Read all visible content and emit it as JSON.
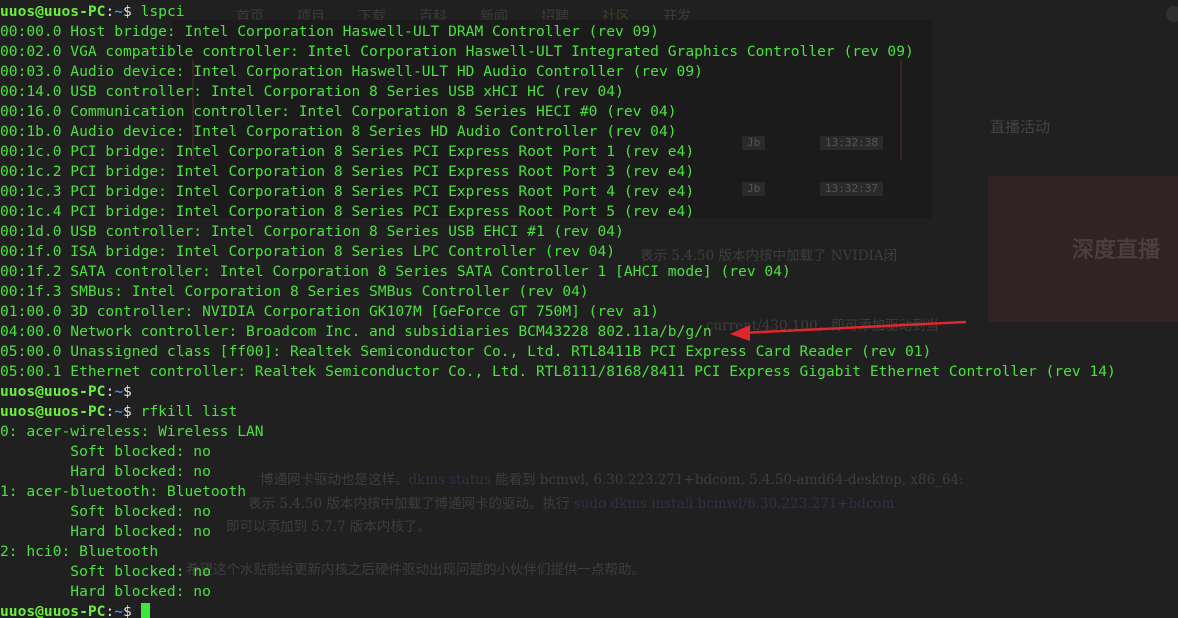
{
  "background_page": {
    "nav": [
      "首页",
      "项目",
      "下载",
      "百科",
      "新闻",
      "招聘",
      "社区",
      "开发"
    ],
    "video_tags": [
      {
        "prefix": "L",
        "label": "Jb",
        "time": "13:32:38"
      },
      {
        "prefix": "L",
        "label": "Jb",
        "time": "13:32:37"
      }
    ],
    "side_title": "直播活动",
    "banner_text": "深度直播",
    "paragraph1": "表示 5.4.50 版本内核中加载了 NVIDIA闭",
    "paragraph2": "current/430.100，即可添加驱动到当",
    "paragraph3_a": "博通网卡驱动也是这样。",
    "paragraph3_link": "dkms status",
    "paragraph3_b": " 能看到 bcmwl, 6.30.223.271+bdcom, 5.4.50-amd64-desktop, x86_64:",
    "paragraph4_a": "表示 5.4.50 版本内核中加载了博通网卡的驱动。执行 ",
    "paragraph4_link": "sudo dkms install bcmwl/6.30.223.271+bdcom",
    "paragraph5": "即可以添加到 5.7.7 版本内核了。",
    "paragraph6": "希望这个水贴能给更新内核之后硬件驱动出现问题的小伙伴们提供一点帮助。"
  },
  "terminal": {
    "prompt_user": "uuos@uuos-PC",
    "prompt_path": "~",
    "prompt_symbol": "$",
    "lines": [
      {
        "type": "prompt",
        "cmd": " lspci"
      },
      {
        "type": "out",
        "text": "00:00.0 Host bridge: Intel Corporation Haswell-ULT DRAM Controller (rev 09)"
      },
      {
        "type": "out",
        "text": "00:02.0 VGA compatible controller: Intel Corporation Haswell-ULT Integrated Graphics Controller (rev 09)"
      },
      {
        "type": "out",
        "text": "00:03.0 Audio device: Intel Corporation Haswell-ULT HD Audio Controller (rev 09)"
      },
      {
        "type": "out",
        "text": "00:14.0 USB controller: Intel Corporation 8 Series USB xHCI HC (rev 04)"
      },
      {
        "type": "out",
        "text": "00:16.0 Communication controller: Intel Corporation 8 Series HECI #0 (rev 04)"
      },
      {
        "type": "out",
        "text": "00:1b.0 Audio device: Intel Corporation 8 Series HD Audio Controller (rev 04)"
      },
      {
        "type": "out",
        "text": "00:1c.0 PCI bridge: Intel Corporation 8 Series PCI Express Root Port 1 (rev e4)"
      },
      {
        "type": "out",
        "text": "00:1c.2 PCI bridge: Intel Corporation 8 Series PCI Express Root Port 3 (rev e4)"
      },
      {
        "type": "out",
        "text": "00:1c.3 PCI bridge: Intel Corporation 8 Series PCI Express Root Port 4 (rev e4)"
      },
      {
        "type": "out",
        "text": "00:1c.4 PCI bridge: Intel Corporation 8 Series PCI Express Root Port 5 (rev e4)"
      },
      {
        "type": "out",
        "text": "00:1d.0 USB controller: Intel Corporation 8 Series USB EHCI #1 (rev 04)"
      },
      {
        "type": "out",
        "text": "00:1f.0 ISA bridge: Intel Corporation 8 Series LPC Controller (rev 04)"
      },
      {
        "type": "out",
        "text": "00:1f.2 SATA controller: Intel Corporation 8 Series SATA Controller 1 [AHCI mode] (rev 04)"
      },
      {
        "type": "out",
        "text": "00:1f.3 SMBus: Intel Corporation 8 Series SMBus Controller (rev 04)"
      },
      {
        "type": "out",
        "text": "01:00.0 3D controller: NVIDIA Corporation GK107M [GeForce GT 750M] (rev a1)"
      },
      {
        "type": "out",
        "text": "04:00.0 Network controller: Broadcom Inc. and subsidiaries BCM43228 802.11a/b/g/n"
      },
      {
        "type": "out",
        "text": "05:00.0 Unassigned class [ff00]: Realtek Semiconductor Co., Ltd. RTL8411B PCI Express Card Reader (rev 01)"
      },
      {
        "type": "out",
        "text": "05:00.1 Ethernet controller: Realtek Semiconductor Co., Ltd. RTL8111/8168/8411 PCI Express Gigabit Ethernet Controller (rev 14)"
      },
      {
        "type": "prompt",
        "cmd": ""
      },
      {
        "type": "prompt",
        "cmd": " rfkill list"
      },
      {
        "type": "out",
        "text": "0: acer-wireless: Wireless LAN"
      },
      {
        "type": "out",
        "text": "        Soft blocked: no"
      },
      {
        "type": "out",
        "text": "        Hard blocked: no"
      },
      {
        "type": "out",
        "text": "1: acer-bluetooth: Bluetooth"
      },
      {
        "type": "out",
        "text": "        Soft blocked: no"
      },
      {
        "type": "out",
        "text": "        Hard blocked: no"
      },
      {
        "type": "out",
        "text": "2: hci0: Bluetooth"
      },
      {
        "type": "out",
        "text": "        Soft blocked: no"
      },
      {
        "type": "out",
        "text": "        Hard blocked: no"
      },
      {
        "type": "prompt",
        "cmd": " ",
        "cursor": true
      }
    ]
  },
  "annotation": {
    "arrow_color": "#e0262e",
    "points_to": "04:00.0 Network controller"
  },
  "colors": {
    "terminal_text": "#48e23a",
    "prompt_user": "#6bef3b",
    "prompt_path": "#3a8fe6",
    "terminal_bg": "#2a2a2a"
  }
}
